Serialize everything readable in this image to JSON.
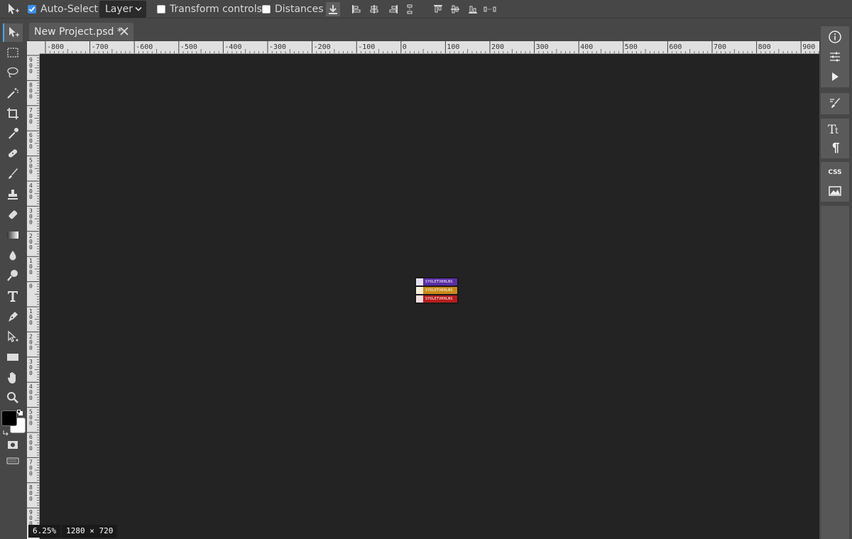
{
  "topbar": {
    "auto_select_label": "Auto-Select",
    "auto_select_checked": true,
    "layer_select": "Layer",
    "transform_label": "Transform controls",
    "distances_label": "Distances"
  },
  "tab": {
    "title": "New Project.psd *"
  },
  "ruler": {
    "top_ticks": [
      "-800",
      "-700",
      "-600",
      "-500",
      "-400",
      "-300",
      "-200",
      "-100",
      "0",
      "100",
      "200",
      "300",
      "400",
      "500",
      "600",
      "700",
      "800",
      "900"
    ],
    "left_ticks": [
      "900",
      "800",
      "700",
      "600",
      "500",
      "400",
      "300",
      "200",
      "100",
      "0",
      "100",
      "200",
      "300",
      "400",
      "500",
      "600",
      "700",
      "800",
      "900"
    ]
  },
  "canvas": {
    "pills": [
      {
        "text": "SYOLETVKHLNS",
        "color": "#5a2ea6",
        "icon": "twitch-icon"
      },
      {
        "text": "SYOLETVKHLNS",
        "color": "#c98a18",
        "icon": "instagram-icon"
      },
      {
        "text": "SYOLETVKHLNS",
        "color": "#b81c1c",
        "icon": "youtube-icon"
      }
    ]
  },
  "status": {
    "zoom": "6.25%",
    "size": "1280 × 720"
  },
  "right": {
    "collapse": "<>",
    "css_label": "CSS"
  },
  "colors": {
    "foreground": "#000000",
    "background": "#ffffff",
    "accent": "#4aa3ff"
  }
}
